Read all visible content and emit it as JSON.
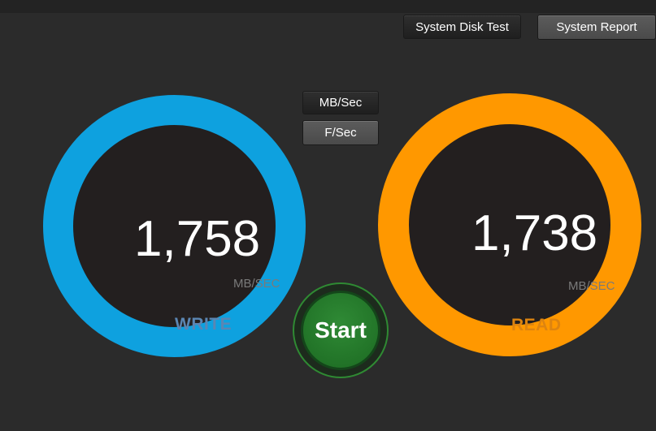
{
  "toolbar": {
    "system_disk_test_label": "System Disk Test",
    "system_report_label": "System Report"
  },
  "units_toggle": {
    "mb_sec_label": "MB/Sec",
    "f_sec_label": "F/Sec",
    "selected": "F/Sec"
  },
  "write": {
    "value": "1,758",
    "unit": "MB/SEC",
    "label": "WRITE",
    "ring_color": "#0ea1df"
  },
  "read": {
    "value": "1,738",
    "unit": "MB/SEC",
    "label": "READ",
    "ring_color": "#ff9800"
  },
  "start": {
    "label": "Start",
    "color": "#2f8a35"
  }
}
